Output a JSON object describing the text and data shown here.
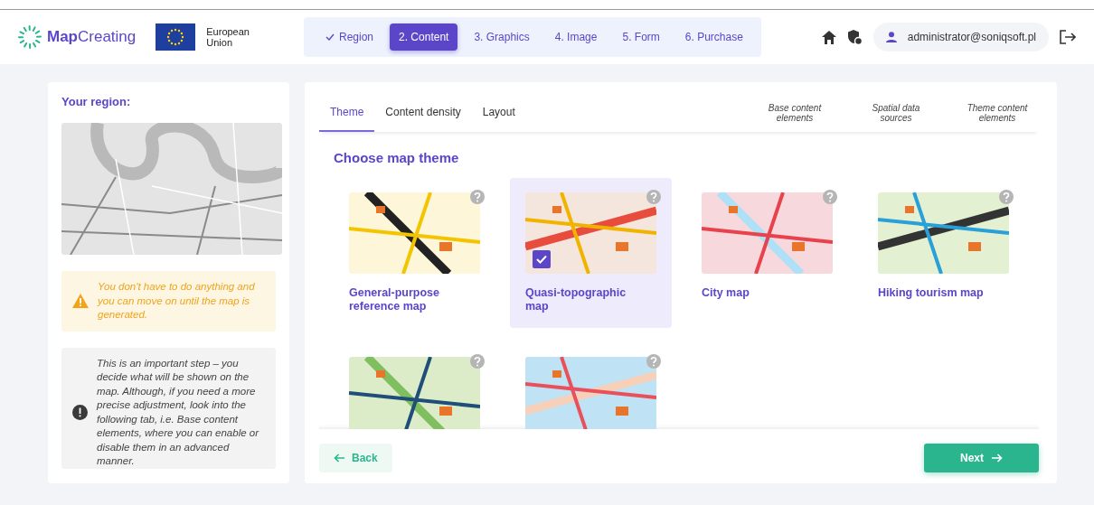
{
  "brand": {
    "name_bold": "Map",
    "name_rest": "Creating",
    "eu_label": "European Union"
  },
  "steps": [
    {
      "label": "Region",
      "done": true,
      "selected": false
    },
    {
      "label": "2. Content",
      "done": false,
      "selected": true
    },
    {
      "label": "3. Graphics",
      "done": false,
      "selected": false
    },
    {
      "label": "4. Image",
      "done": false,
      "selected": false
    },
    {
      "label": "5. Form",
      "done": false,
      "selected": false
    },
    {
      "label": "6. Purchase",
      "done": false,
      "selected": false
    }
  ],
  "user": {
    "email": "administrator@soniqsoft.pl"
  },
  "sidebar": {
    "title": "Your region:",
    "notes": [
      {
        "kind": "warning",
        "text": "You don't have to do anything and you can move on until the map is generated."
      },
      {
        "kind": "info",
        "text": "This is an important step – you decide what will be shown on the map. Although, if you need a more precise adjustment, look into the following tab, i.e. Base content elements, where you can enable or disable them in an advanced manner."
      }
    ]
  },
  "tabs": [
    {
      "label": "Theme",
      "selected": true
    },
    {
      "label": "Content density",
      "selected": false
    },
    {
      "label": "Layout",
      "selected": false
    }
  ],
  "advanced_tabs": [
    "Base content elements",
    "Spatial data sources",
    "Theme content elements"
  ],
  "section_title": "Choose map theme",
  "themes": [
    {
      "title": "General-purpose reference map",
      "selected": false
    },
    {
      "title": "Quasi-topographic map",
      "selected": true
    },
    {
      "title": "City map",
      "selected": false
    },
    {
      "title": "Hiking tourism map",
      "selected": false
    },
    {
      "selected": false
    },
    {
      "selected": false
    }
  ],
  "buttons": {
    "back": "Back",
    "next": "Next"
  }
}
